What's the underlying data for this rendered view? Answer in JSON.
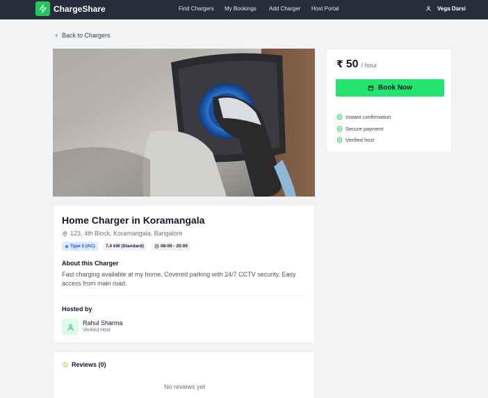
{
  "navbar": {
    "brand": "ChargeShare",
    "links": [
      "Find Chargers",
      "My Bookings",
      "Add Charger",
      "Host Portal"
    ],
    "user_name": "Vega Darsi"
  },
  "back_link": "Back to Chargers",
  "charger": {
    "title": "Home Charger in Koramangala",
    "address": "123, 4th Block, Koramangala, Bangalore",
    "chips": {
      "type": "Type 2 (AC)",
      "power": "7.4 kW (Standard)",
      "hours": "08:00 - 20:00"
    },
    "about_title": "About this Charger",
    "description": "Fast charging available at my home. Covered parking with 24/7 CCTV security. Easy access from main road.",
    "hosted_by_title": "Hosted by",
    "host_name": "Rahul Sharma",
    "host_role": "Verified Host"
  },
  "reviews": {
    "title": "Reviews (0)",
    "empty_text": "No reviews yet"
  },
  "booking": {
    "currency": "₹",
    "price": "50",
    "unit": "/ hour",
    "book_label": "Book Now",
    "features": [
      "Instant confirmation",
      "Secure payment",
      "Verified host"
    ]
  },
  "colors": {
    "accent": "#22e46e",
    "nav_bg": "#262d3b",
    "page_bg": "#f1f3f5"
  }
}
